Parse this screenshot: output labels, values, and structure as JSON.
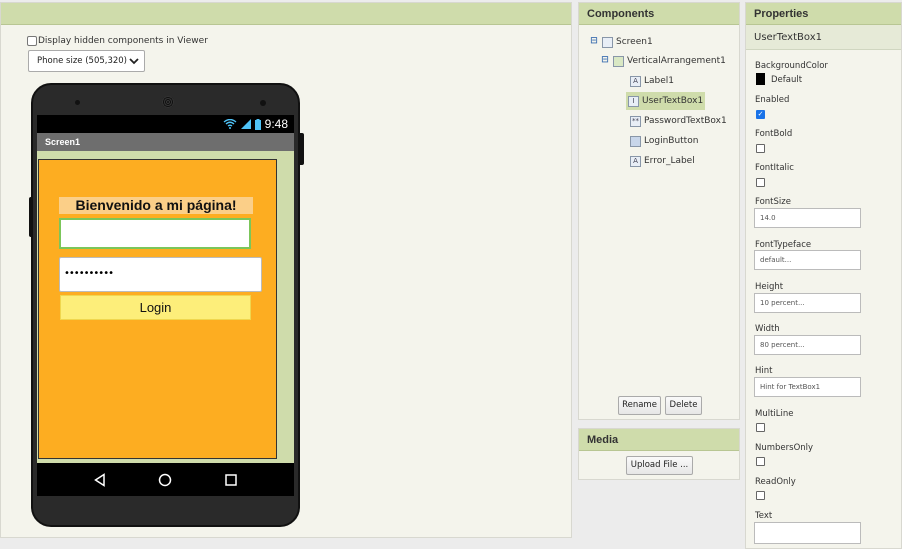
{
  "viewer": {
    "hidden_components_label": "Display hidden components in Viewer",
    "size_select_value": "Phone size (505,320)"
  },
  "phone": {
    "status_time": "9:48",
    "screen_title": "Screen1",
    "welcome_text": "Bienvenido a mi página!",
    "password_mask": "••••••••••",
    "login_label": "Login"
  },
  "components": {
    "title": "Components",
    "tree": [
      {
        "label": "Screen1",
        "toggle": "⊟",
        "icon": "screen-icon"
      },
      {
        "label": "VerticalArrangement1",
        "toggle": "⊟",
        "icon": "arrangement-icon"
      },
      {
        "label": "Label1",
        "icon": "label-icon"
      },
      {
        "label": "UserTextBox1",
        "icon": "textbox-icon"
      },
      {
        "label": "PasswordTextBox1",
        "icon": "password-icon"
      },
      {
        "label": "LoginButton",
        "icon": "button-icon"
      },
      {
        "label": "Error_Label",
        "icon": "label-icon"
      }
    ],
    "selected": "UserTextBox1",
    "rename_label": "Rename",
    "delete_label": "Delete"
  },
  "media": {
    "title": "Media",
    "upload_label": "Upload File ..."
  },
  "properties": {
    "title": "Properties",
    "component_name": "UserTextBox1",
    "background_color_label": "BackgroundColor",
    "background_color_value": "Default",
    "enabled_label": "Enabled",
    "enabled": true,
    "font_bold_label": "FontBold",
    "font_bold": false,
    "font_italic_label": "FontItalic",
    "font_italic": false,
    "font_size_label": "FontSize",
    "font_size_value": "14.0",
    "font_typeface_label": "FontTypeface",
    "font_typeface_value": "default...",
    "height_label": "Height",
    "height_value": "10 percent...",
    "width_label": "Width",
    "width_value": "80 percent...",
    "hint_label": "Hint",
    "hint_value": "Hint for TextBox1",
    "multiline_label": "MultiLine",
    "multiline": false,
    "numbers_only_label": "NumbersOnly",
    "numbers_only": false,
    "readonly_label": "ReadOnly",
    "readonly": false,
    "text_label": "Text",
    "text_value": ""
  },
  "colors": {
    "header_green": "#cfdcab",
    "arrangement_orange": "#fdad21",
    "label_bg": "#fbcf88",
    "button_yellow": "#fdee7a",
    "textbox_border": "#7bc65a"
  }
}
